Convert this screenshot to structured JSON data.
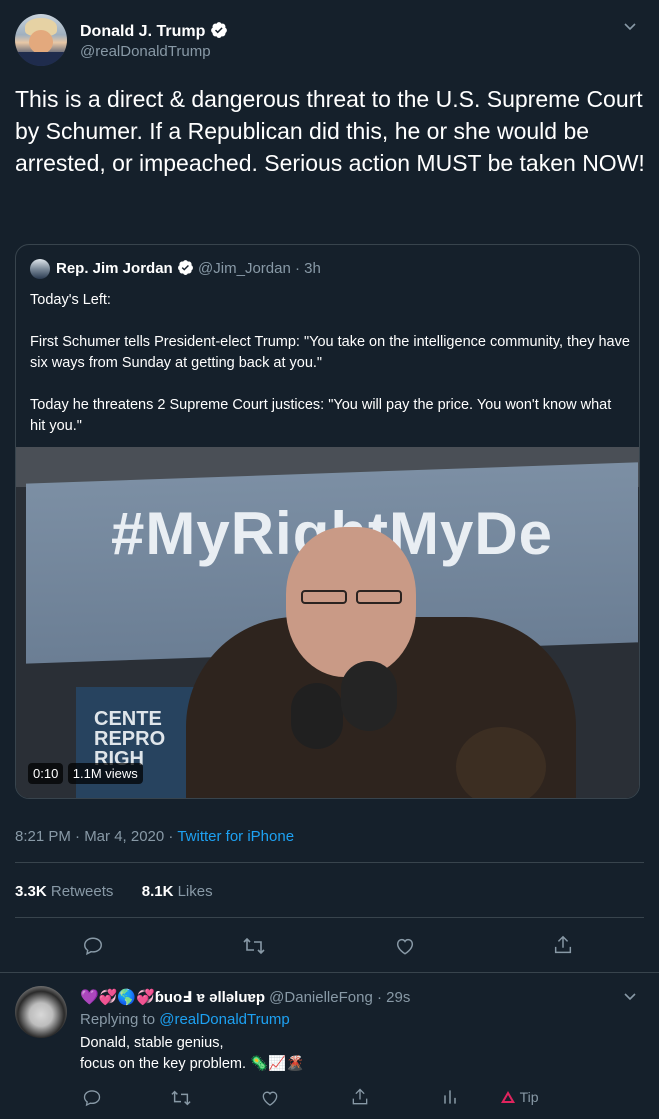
{
  "main_tweet": {
    "author_name": "Donald J. Trump",
    "author_handle": "@realDonaldTrump",
    "text": "This is a direct & dangerous threat to the U.S. Supreme Court by Schumer. If a Republican did this, he or she would be arrested, or impeached. Serious action MUST be taken NOW!",
    "time": "8:21 PM · Mar 4, 2020 · ",
    "source": "Twitter for iPhone",
    "retweets_count": "3.3K",
    "retweets_label": "Retweets",
    "likes_count": "8.1K",
    "likes_label": "Likes"
  },
  "quoted_tweet": {
    "author_name": "Rep. Jim Jordan",
    "author_handle": "@Jim_Jordan",
    "age": "· 3h",
    "line1": "Today's Left:",
    "line2": "First Schumer tells President-elect Trump: \"You take on the intelligence community, they have six ways from Sunday at getting back at you.\"",
    "line3": "Today he threatens 2 Supreme Court justices: \"You will pay the price. You won't know what hit you.\"",
    "video": {
      "banner_text": "#MyRightMyDe",
      "sign_text_1": "CENTE",
      "sign_text_2": "REPRO",
      "sign_text_3": "RIGH",
      "duration": "0:10",
      "views": "1.1M views"
    }
  },
  "reply": {
    "author_name": "ɓuoℲ ɐ ǝllǝluɐp",
    "author_emoji": "💜💞🌎💞",
    "author_handle": "@DanielleFong",
    "age": "· 29s",
    "replying_prefix": "Replying to ",
    "replying_to": "@realDonaldTrump",
    "line1": "Donald, stable genius,",
    "line2": "focus on the key problem.",
    "line2_emoji": "🦠📈🌋",
    "tip_label": "Tip"
  },
  "colors": {
    "background": "#15202b",
    "muted": "#8899a6",
    "link": "#1da1f2",
    "divider": "#38444d",
    "verified": "#1da1f2"
  }
}
